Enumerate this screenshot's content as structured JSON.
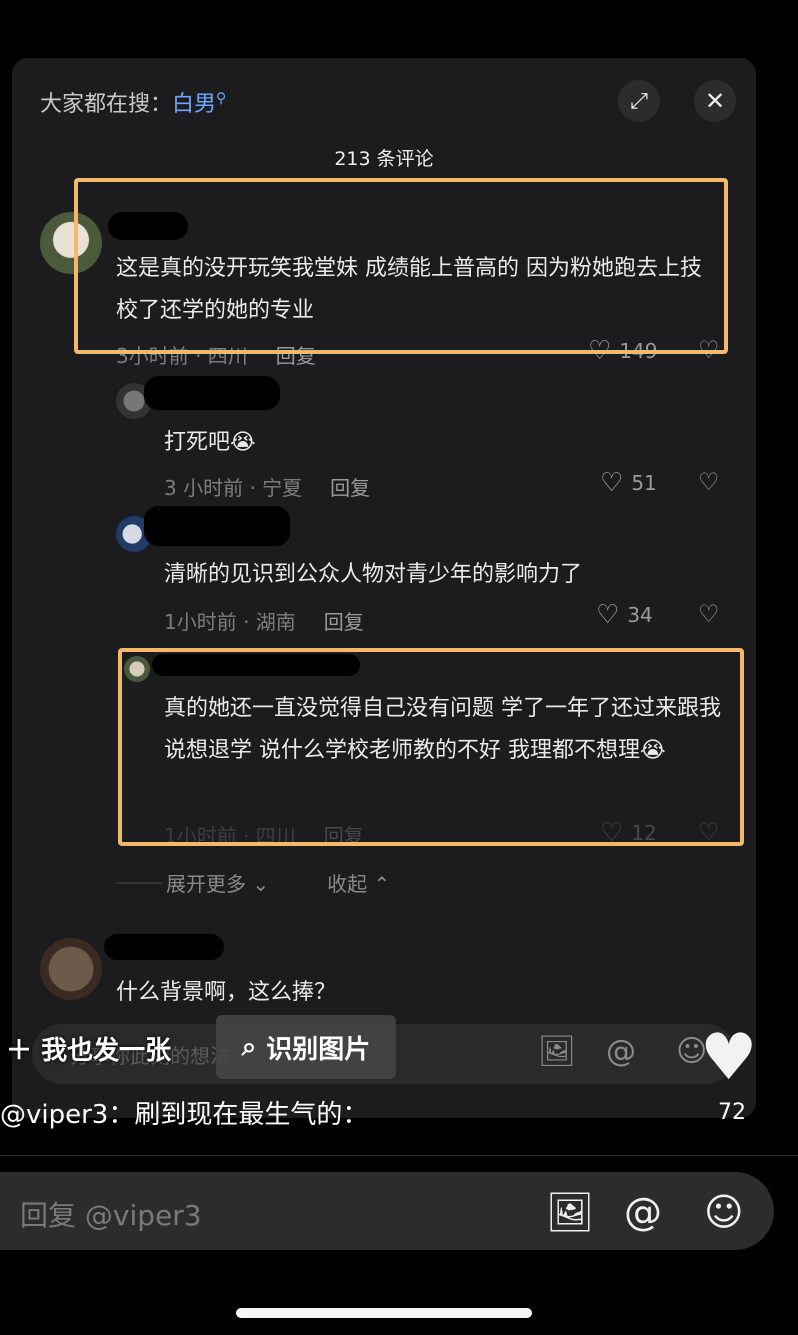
{
  "header": {
    "search_prefix": "大家都在搜：",
    "search_keyword": "白男",
    "comment_count": "213 条评论"
  },
  "comments": [
    {
      "text": "这是真的没开玩笑我堂妹 成绩能上普高的 因为粉她跑去上技校了还学的她的专业",
      "time_location": "3小时前 · 四川",
      "reply_label": "回复",
      "likes": "149"
    },
    {
      "text": "打死吧😭",
      "time_location": "3 小时前 · 宁夏",
      "reply_label": "回复",
      "likes": "51"
    },
    {
      "text": "清晰的见识到公众人物对青少年的影响力了",
      "time_location": "1小时前 · 湖南",
      "reply_label": "回复",
      "likes": "34"
    },
    {
      "text": "真的她还一直没觉得自己没有问题 学了一年了还过来跟我说想退学 说什么学校老师教的不好 我理都不想理😭",
      "time_location": "1小时前 · 四川",
      "reply_label": "回复",
      "likes": "12"
    },
    {
      "text": "什么背景啊，这么捧？"
    }
  ],
  "replies_controls": {
    "expand_more": "展开更多",
    "collapse": "收起"
  },
  "input": {
    "placeholder": "分享你此刻的想法"
  },
  "overlay": {
    "post_too": "我也发一张",
    "identify_image": "识别图片",
    "big_like_count": "72"
  },
  "caption": "@viper3：刷到现在最生气的：",
  "reply_bar": {
    "placeholder": "回复 @viper3"
  },
  "colors": {
    "highlight_box": "#f4b86a",
    "keyword": "#6ea6ff",
    "panel_bg": "#1c1c1e"
  }
}
